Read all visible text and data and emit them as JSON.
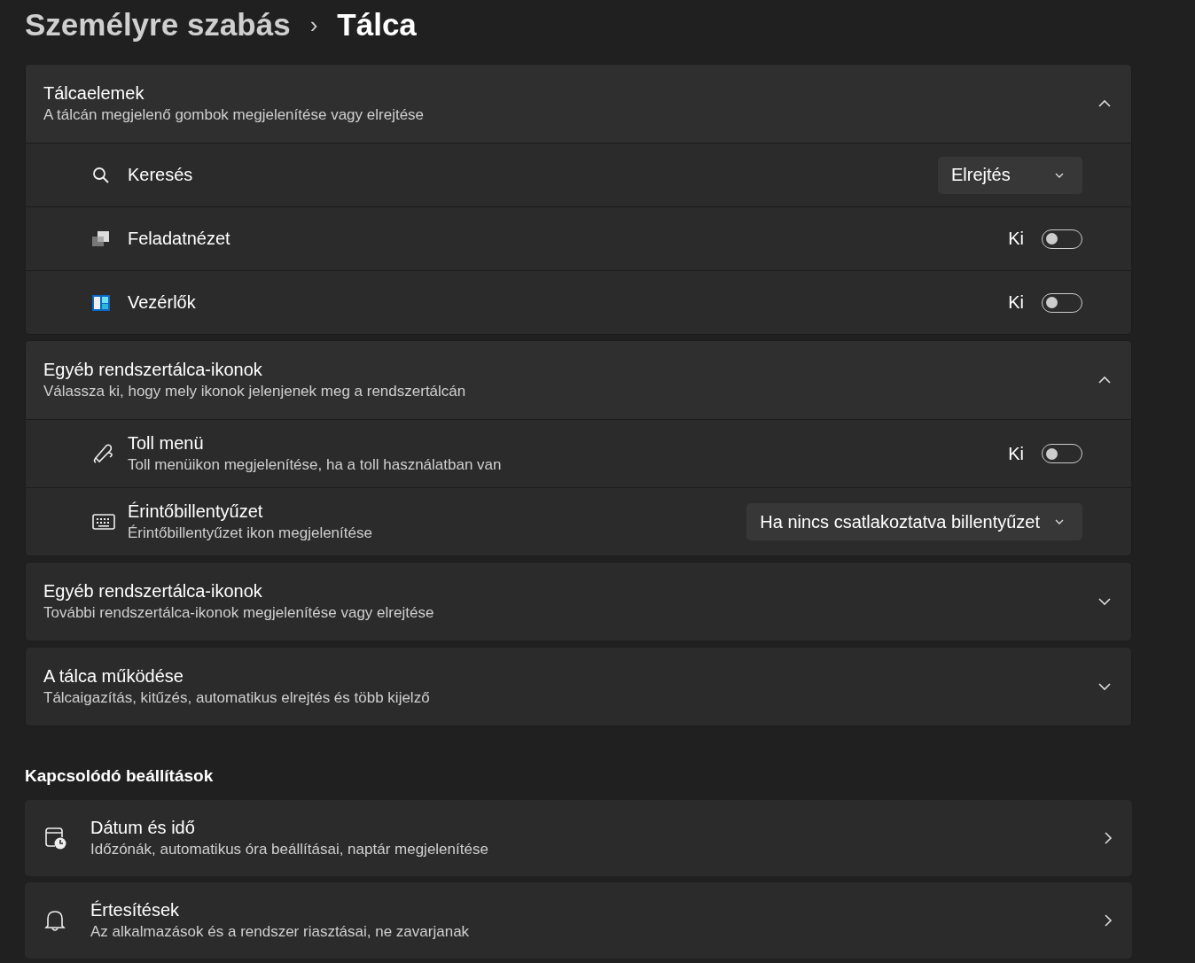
{
  "breadcrumb": {
    "parent": "Személyre szabás",
    "separator": "›",
    "current": "Tálca"
  },
  "sections": [
    {
      "title": "Tálcaelemek",
      "subtitle": "A tálcán megjelenő gombok megjelenítése vagy elrejtése",
      "expanded": true,
      "items": [
        {
          "kind": "dropdown",
          "label": "Keresés",
          "value": "Elrejtés"
        },
        {
          "kind": "toggle",
          "label": "Feladatnézet",
          "state_label": "Ki",
          "on": false
        },
        {
          "kind": "toggle",
          "label": "Vezérlők",
          "state_label": "Ki",
          "on": false
        }
      ]
    },
    {
      "title": "Egyéb rendszertálca-ikonok",
      "subtitle": "Válassza ki, hogy mely ikonok jelenjenek meg a rendszertálcán",
      "expanded": true,
      "items": [
        {
          "kind": "toggle",
          "label": "Toll menü",
          "description": "Toll menüikon megjelenítése, ha a toll használatban van",
          "state_label": "Ki",
          "on": false
        },
        {
          "kind": "dropdown",
          "label": "Érintőbillentyűzet",
          "description": "Érintőbillentyűzet ikon megjelenítése",
          "value": "Ha nincs csatlakoztatva billentyűzet"
        }
      ]
    },
    {
      "title": "Egyéb rendszertálca-ikonok",
      "subtitle": "További rendszertálca-ikonok megjelenítése vagy elrejtése",
      "expanded": false
    },
    {
      "title": "A tálca működése",
      "subtitle": "Tálcaigazítás, kitűzés, automatikus elrejtés és több kijelző",
      "expanded": false
    }
  ],
  "related": {
    "heading": "Kapcsolódó beállítások",
    "items": [
      {
        "title": "Dátum és idő",
        "subtitle": "Időzónák, automatikus óra beállításai, naptár megjelenítése"
      },
      {
        "title": "Értesítések",
        "subtitle": "Az alkalmazások és a rendszer riasztásai, ne zavarjanak"
      }
    ]
  }
}
